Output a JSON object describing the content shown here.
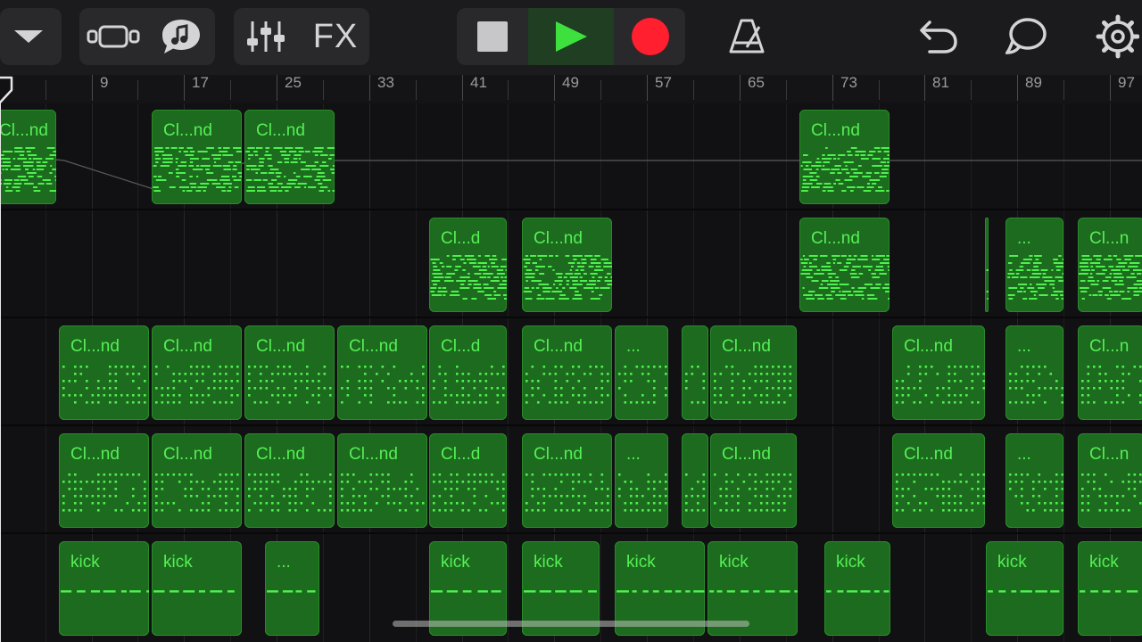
{
  "toolbar": {
    "browser_button": "chevron-down-icon",
    "view_toggle": "tracks-view-icon",
    "instrument_button": "smart-instrument-icon",
    "mixer_button": "mixer-sliders-icon",
    "fx_label": "FX",
    "stop_button": "stop-icon",
    "play_button": "play-icon",
    "record_button": "record-icon",
    "metronome_button": "metronome-icon",
    "undo_button": "undo-icon",
    "loop_button": "loop-browser-icon",
    "settings_button": "gear-icon",
    "colors": {
      "play": "#3ee03e",
      "record": "#ff1f2f",
      "stop": "#c7c7c9",
      "play_bg": "#1f3e22"
    }
  },
  "ruler": {
    "bars": [
      {
        "label": "9",
        "bar": 9
      },
      {
        "label": "17",
        "bar": 17
      },
      {
        "label": "25",
        "bar": 25
      },
      {
        "label": "33",
        "bar": 33
      },
      {
        "label": "41",
        "bar": 41
      },
      {
        "label": "49",
        "bar": 49
      },
      {
        "label": "57",
        "bar": 57
      },
      {
        "label": "65",
        "bar": 65
      },
      {
        "label": "73",
        "bar": 73
      },
      {
        "label": "81",
        "bar": 81
      },
      {
        "label": "89",
        "bar": 89
      },
      {
        "label": "97",
        "bar": 97
      }
    ]
  },
  "tracks": [
    {
      "regions": [
        {
          "label": "Cl...nd",
          "start": 0,
          "end": 5.9,
          "pattern": "dense"
        },
        {
          "label": "Cl...nd",
          "start": 14.2,
          "end": 22.0,
          "pattern": "dense"
        },
        {
          "label": "Cl...nd",
          "start": 22.2,
          "end": 30.0,
          "pattern": "dense"
        },
        {
          "label": "Cl...nd",
          "start": 70.2,
          "end": 78.0,
          "pattern": "dense"
        }
      ]
    },
    {
      "regions": [
        {
          "label": "Cl...d",
          "start": 38.2,
          "end": 44.9,
          "pattern": "dense"
        },
        {
          "label": "Cl...nd",
          "start": 46.2,
          "end": 54.0,
          "pattern": "dense"
        },
        {
          "label": "Cl...nd",
          "start": 70.2,
          "end": 78.0,
          "pattern": "dense"
        },
        {
          "label": "",
          "start": 86.2,
          "end": 86.5,
          "pattern": "dense"
        },
        {
          "label": "...",
          "start": 88.0,
          "end": 93.0,
          "pattern": "dense"
        },
        {
          "label": "Cl...n",
          "start": 94.2,
          "end": 100.0,
          "pattern": "dense"
        }
      ]
    },
    {
      "regions": [
        {
          "label": "Cl...nd",
          "start": 6.2,
          "end": 14.0,
          "pattern": "sparse"
        },
        {
          "label": "Cl...nd",
          "start": 14.2,
          "end": 22.0,
          "pattern": "sparse"
        },
        {
          "label": "Cl...nd",
          "start": 22.2,
          "end": 30.0,
          "pattern": "sparse"
        },
        {
          "label": "Cl...nd",
          "start": 30.2,
          "end": 38.0,
          "pattern": "sparse"
        },
        {
          "label": "Cl...d",
          "start": 38.2,
          "end": 44.9,
          "pattern": "sparse"
        },
        {
          "label": "Cl...nd",
          "start": 46.2,
          "end": 54.0,
          "pattern": "sparse"
        },
        {
          "label": "...",
          "start": 54.2,
          "end": 58.8,
          "pattern": "sparse"
        },
        {
          "label": "",
          "start": 60.0,
          "end": 62.3,
          "pattern": "sparse"
        },
        {
          "label": "Cl...nd",
          "start": 62.5,
          "end": 70.0,
          "pattern": "sparse"
        },
        {
          "label": "Cl...nd",
          "start": 78.2,
          "end": 86.2,
          "pattern": "sparse"
        },
        {
          "label": "...",
          "start": 88.0,
          "end": 93.0,
          "pattern": "sparse"
        },
        {
          "label": "Cl...n",
          "start": 94.2,
          "end": 100.0,
          "pattern": "sparse"
        }
      ]
    },
    {
      "regions": [
        {
          "label": "Cl...nd",
          "start": 6.2,
          "end": 14.0,
          "pattern": "sparse"
        },
        {
          "label": "Cl...nd",
          "start": 14.2,
          "end": 22.0,
          "pattern": "sparse"
        },
        {
          "label": "Cl...nd",
          "start": 22.2,
          "end": 30.0,
          "pattern": "sparse"
        },
        {
          "label": "Cl...nd",
          "start": 30.2,
          "end": 38.0,
          "pattern": "sparse"
        },
        {
          "label": "Cl...d",
          "start": 38.2,
          "end": 44.9,
          "pattern": "sparse"
        },
        {
          "label": "Cl...nd",
          "start": 46.2,
          "end": 54.0,
          "pattern": "sparse"
        },
        {
          "label": "...",
          "start": 54.2,
          "end": 58.8,
          "pattern": "sparse"
        },
        {
          "label": "",
          "start": 60.0,
          "end": 62.3,
          "pattern": "sparse"
        },
        {
          "label": "Cl...nd",
          "start": 62.5,
          "end": 70.0,
          "pattern": "sparse"
        },
        {
          "label": "Cl...nd",
          "start": 78.2,
          "end": 86.2,
          "pattern": "sparse"
        },
        {
          "label": "...",
          "start": 88.0,
          "end": 93.0,
          "pattern": "sparse"
        },
        {
          "label": "Cl...n",
          "start": 94.2,
          "end": 100.0,
          "pattern": "sparse"
        }
      ]
    },
    {
      "regions": [
        {
          "label": "kick",
          "start": 6.2,
          "end": 14.0,
          "pattern": "kick"
        },
        {
          "label": "kick",
          "start": 14.2,
          "end": 22.0,
          "pattern": "kick"
        },
        {
          "label": "...",
          "start": 24.0,
          "end": 28.7,
          "pattern": "kick"
        },
        {
          "label": "kick",
          "start": 38.2,
          "end": 44.9,
          "pattern": "kick"
        },
        {
          "label": "kick",
          "start": 46.2,
          "end": 52.9,
          "pattern": "kick"
        },
        {
          "label": "kick",
          "start": 54.2,
          "end": 62.0,
          "pattern": "kick"
        },
        {
          "label": "kick",
          "start": 62.2,
          "end": 70.0,
          "pattern": "kick"
        },
        {
          "label": "kick",
          "start": 72.3,
          "end": 78.0,
          "pattern": "kick"
        },
        {
          "label": "kick",
          "start": 86.3,
          "end": 93.0,
          "pattern": "kick"
        },
        {
          "label": "kick",
          "start": 94.2,
          "end": 100.0,
          "pattern": "kick"
        }
      ]
    }
  ],
  "playhead": {
    "bar": 1.1
  },
  "colors": {
    "region_fill": "#1d6b1e",
    "note_color": "#4ef04e",
    "background": "#111113"
  }
}
